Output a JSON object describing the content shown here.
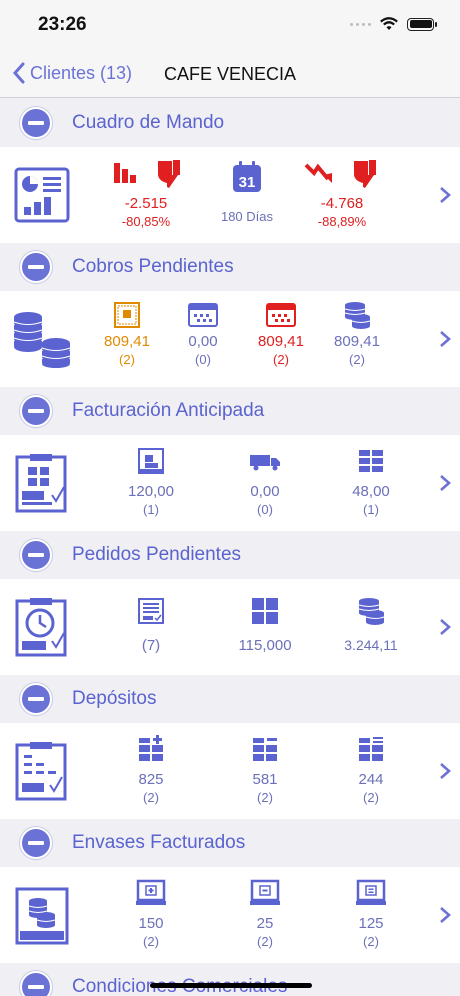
{
  "status": {
    "time": "23:26"
  },
  "nav": {
    "back_label": "Clientes (13)",
    "title": "CAFE VENECIA"
  },
  "colors": {
    "accent": "#5b63d0",
    "negative": "#e02020",
    "warning": "#e08a00",
    "header_bg": "#efeff4"
  },
  "sections": {
    "cuadro": {
      "title": "Cuadro de Mando",
      "m1": {
        "icon": "bar-chart-down-icon",
        "value": "-2.515",
        "sub": "-80,85%"
      },
      "m2": {
        "icon": "calendar-31-icon",
        "day": "31",
        "value": "180 Días"
      },
      "m3": {
        "icon": "trend-down-icon",
        "value": "-4.768",
        "sub": "-88,89%"
      }
    },
    "cobros": {
      "title": "Cobros Pendientes",
      "m1": {
        "icon": "invoice-orange-icon",
        "value": "809,41",
        "sub": "(2)"
      },
      "m2": {
        "icon": "calendar-grid-icon",
        "value": "0,00",
        "sub": "(0)"
      },
      "m3": {
        "icon": "calendar-red-icon",
        "value": "809,41",
        "sub": "(2)"
      },
      "m4": {
        "icon": "coins-stack-icon",
        "value": "809,41",
        "sub": "(2)"
      }
    },
    "facturacion": {
      "title": "Facturación Anticipada",
      "m1": {
        "icon": "box-document-icon",
        "value": "120,00",
        "sub": "(1)"
      },
      "m2": {
        "icon": "truck-icon",
        "value": "0,00",
        "sub": "(0)"
      },
      "m3": {
        "icon": "stack-boxes-icon",
        "value": "48,00",
        "sub": "(1)"
      }
    },
    "pedidos": {
      "title": "Pedidos Pendientes",
      "m1": {
        "icon": "checklist-icon",
        "value": "(7)"
      },
      "m2": {
        "icon": "grid-squares-icon",
        "value": "115,000"
      },
      "m3": {
        "icon": "coins-icon",
        "value": "3.244,11"
      }
    },
    "depositos": {
      "title": "Depósitos",
      "m1": {
        "icon": "boxes-plus-icon",
        "value": "825",
        "sub": "(2)"
      },
      "m2": {
        "icon": "boxes-minus-icon",
        "value": "581",
        "sub": "(2)"
      },
      "m3": {
        "icon": "boxes-equal-icon",
        "value": "244",
        "sub": "(2)"
      }
    },
    "envases": {
      "title": "Envases Facturados",
      "m1": {
        "icon": "monitor-plus-icon",
        "value": "150",
        "sub": "(2)"
      },
      "m2": {
        "icon": "monitor-minus-icon",
        "value": "25",
        "sub": "(2)"
      },
      "m3": {
        "icon": "monitor-equal-icon",
        "value": "125",
        "sub": "(2)"
      }
    },
    "condiciones": {
      "title": "Condiciones Comerciales"
    }
  }
}
